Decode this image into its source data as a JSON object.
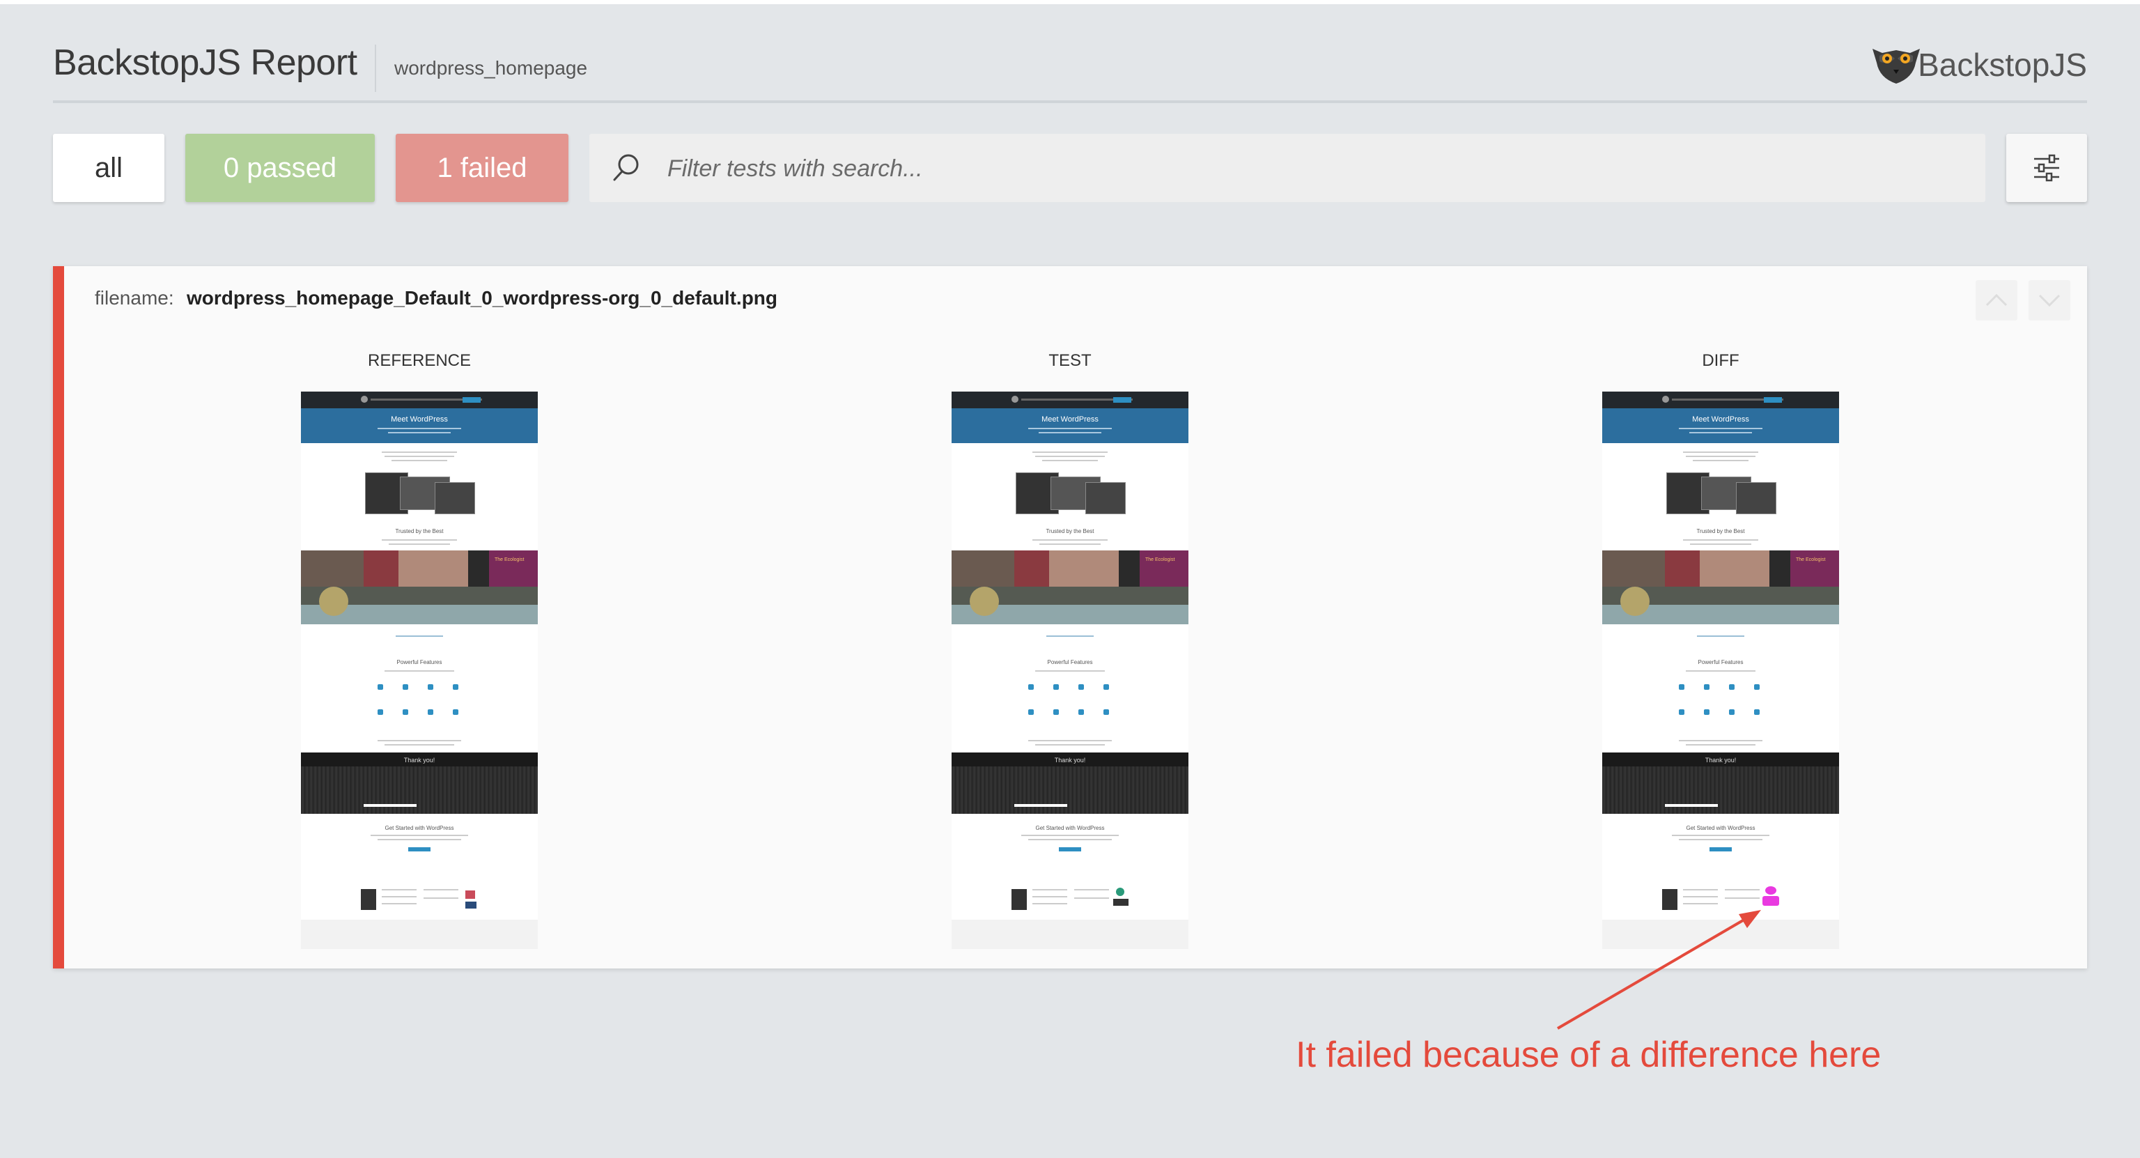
{
  "header": {
    "title": "BackstopJS Report",
    "subtitle": "wordpress_homepage",
    "logo_text": "BackstopJS",
    "logo_icon": "lemur-icon"
  },
  "filters": {
    "all_label": "all",
    "passed_label": "0 passed",
    "failed_label": "1 failed",
    "search_placeholder": "Filter tests with search...",
    "settings_icon": "sliders-icon"
  },
  "test": {
    "filename_label": "filename:",
    "filename_value": "wordpress_homepage_Default_0_wordpress-org_0_default.png",
    "status": "failed",
    "columns": {
      "reference": "REFERENCE",
      "test": "TEST",
      "diff": "DIFF"
    },
    "thumbnail": {
      "hero_title": "Meet WordPress",
      "trusted_heading": "Trusted by the Best",
      "features_heading": "Powerful Features",
      "thanks_heading": "Thank you!",
      "get_started_heading": "Get Started with WordPress"
    }
  },
  "annotation": {
    "text": "It failed because of a difference here"
  },
  "colors": {
    "fail": "#e44a3c",
    "passed_bg": "#b2d19a",
    "failed_bg": "#e3958f",
    "diff_highlight": "#e93ae0"
  }
}
